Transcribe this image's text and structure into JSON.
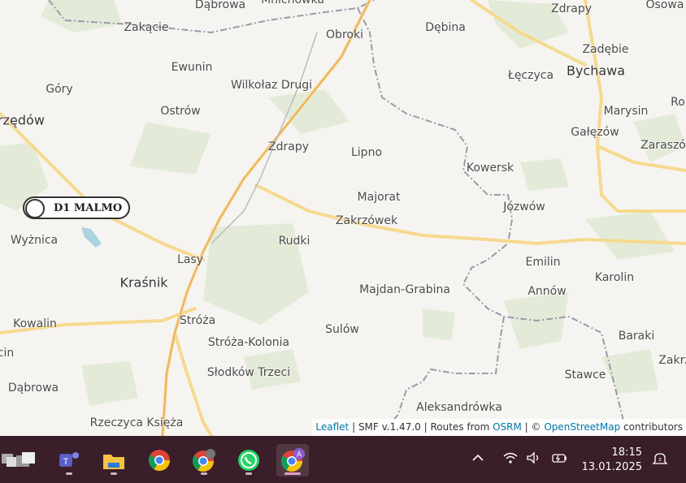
{
  "map": {
    "places": [
      {
        "id": "dabrowa-top",
        "name": "Dąbrowa"
      },
      {
        "id": "mandanowka",
        "name": "Mnichówka"
      },
      {
        "id": "zakacie",
        "name": "Zakącie"
      },
      {
        "id": "obroki",
        "name": "Obroki"
      },
      {
        "id": "debina",
        "name": "Dębina"
      },
      {
        "id": "zdrapy-ne",
        "name": "Zdrapy"
      },
      {
        "id": "osowa",
        "name": "Osowa"
      },
      {
        "id": "zadebie",
        "name": "Zadębie"
      },
      {
        "id": "ewunin",
        "name": "Ewunin"
      },
      {
        "id": "leczyca",
        "name": "Łęczyca"
      },
      {
        "id": "bychawa",
        "name": "Bychawa"
      },
      {
        "id": "gory",
        "name": "Góry"
      },
      {
        "id": "wilkolaz",
        "name": "Wilkołaz Drugi"
      },
      {
        "id": "ostrow",
        "name": "Ostrów"
      },
      {
        "id": "marysin",
        "name": "Marysin"
      },
      {
        "id": "rox",
        "name": "Ro"
      },
      {
        "id": "urzedow",
        "name": "rzędów"
      },
      {
        "id": "galezow",
        "name": "Gałęzów"
      },
      {
        "id": "zdrapy",
        "name": "Zdrapy"
      },
      {
        "id": "lipno",
        "name": "Lipno"
      },
      {
        "id": "zaraszow",
        "name": "Zaraszó"
      },
      {
        "id": "kowersk",
        "name": "Kowersk"
      },
      {
        "id": "majorat",
        "name": "Majorat"
      },
      {
        "id": "jozwow",
        "name": "Józwów"
      },
      {
        "id": "zakrzowek",
        "name": "Zakrzówek"
      },
      {
        "id": "wyznica",
        "name": "Wyżnica"
      },
      {
        "id": "rudki",
        "name": "Rudki"
      },
      {
        "id": "lasy",
        "name": "Lasy"
      },
      {
        "id": "emilin",
        "name": "Emilin"
      },
      {
        "id": "krasnik",
        "name": "Kraśnik"
      },
      {
        "id": "karolin",
        "name": "Karolin"
      },
      {
        "id": "majdan",
        "name": "Majdan-Grabina"
      },
      {
        "id": "annow",
        "name": "Annów"
      },
      {
        "id": "stroza",
        "name": "Stróża"
      },
      {
        "id": "kowalin",
        "name": "Kowalin"
      },
      {
        "id": "sulow",
        "name": "Sulów"
      },
      {
        "id": "baraki",
        "name": "Baraki"
      },
      {
        "id": "stroza-kolonia",
        "name": "Stróża-Kolonia"
      },
      {
        "id": "cin",
        "name": "cin"
      },
      {
        "id": "zakrz-e",
        "name": "Zakrz"
      },
      {
        "id": "slodkow",
        "name": "Słodków Trzeci"
      },
      {
        "id": "stawce",
        "name": "Stawce"
      },
      {
        "id": "dabrowa",
        "name": "Dąbrowa"
      },
      {
        "id": "aleksandrowka",
        "name": "Aleksandrówka"
      },
      {
        "id": "rzeczyca",
        "name": "Rzeczyca Księża"
      }
    ],
    "marker_label": "D1 MALMO"
  },
  "attribution": {
    "leaflet": "Leaflet",
    "sep1": " | SMF v.1.47.0 | Routes from ",
    "osrm": "OSRM",
    "sep2": " | © ",
    "osm": "OpenStreetMap",
    "contributors": " contributors"
  },
  "taskbar": {
    "apps": [
      {
        "name": "task-view",
        "icon": "task-view-icon"
      },
      {
        "name": "teams",
        "icon": "teams-icon"
      },
      {
        "name": "file-explorer",
        "icon": "folder-icon"
      },
      {
        "name": "chrome",
        "icon": "chrome-icon"
      },
      {
        "name": "chrome-incognito",
        "icon": "chrome-icon"
      },
      {
        "name": "whatsapp",
        "icon": "whatsapp-icon"
      },
      {
        "name": "chrome-profile",
        "icon": "chrome-icon"
      }
    ],
    "clock": {
      "time": "18:15",
      "date": "13.01.2025"
    },
    "profile_badge": "A"
  }
}
